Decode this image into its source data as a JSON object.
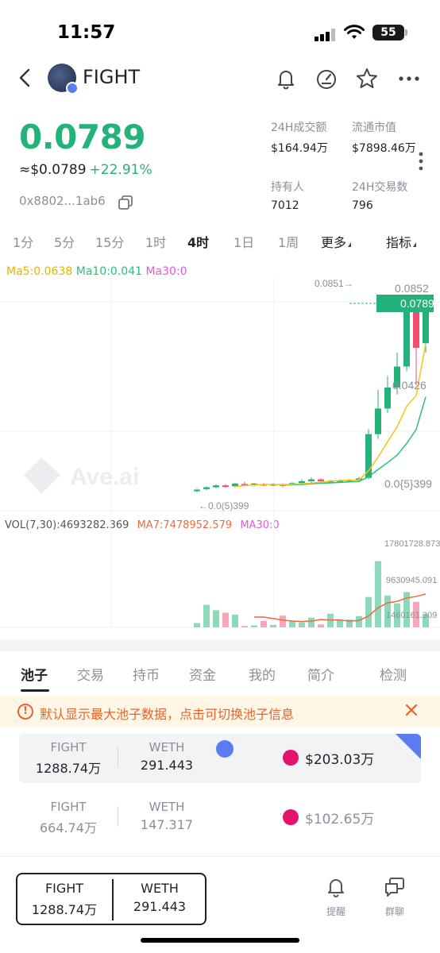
{
  "status_bar": {
    "time": "11:57",
    "battery": "55"
  },
  "header": {
    "token_name": "FIGHT"
  },
  "price": {
    "main": "0.0789",
    "usd": "≈$0.0789",
    "change": "+22.91%",
    "address": "0x8802...1ab6"
  },
  "stats": {
    "vol24h_label": "24H成交额",
    "vol24h_value": "$164.94万",
    "mcap_label": "流通市值",
    "mcap_value": "$7898.46万",
    "holders_label": "持有人",
    "holders_value": "7012",
    "tx24h_label": "24H交易数",
    "tx24h_value": "796"
  },
  "timeframes": [
    "1分",
    "5分",
    "15分",
    "1时",
    "4时",
    "1日",
    "1周",
    "更多",
    "指标"
  ],
  "active_timeframe": "4时",
  "chart": {
    "ma5": "Ma5:0.0638",
    "ma10": "Ma10:0.041",
    "ma30": "Ma30:0",
    "price_ticks": [
      "0.0852",
      "0.0426",
      "0.0{5}399"
    ],
    "current_tag": "0.0789",
    "high_marker": "0.0851→",
    "low_marker": "←0.0(5)399",
    "watermark": "Ave.ai",
    "vol_label": "VOL(7,30):4693282.369",
    "vol_ma7": "MA7:7478952.579",
    "vol_ma30": "MA30:0",
    "vol_ticks": [
      "17801728.873",
      "9630945.091",
      "1460161.309"
    ],
    "colors": {
      "up": "#23b27a",
      "down": "#f0506e",
      "ma5": "#f5c518",
      "ma10": "#2bbf7a",
      "ma30": "#e05ad6",
      "vol_ma7": "#ee6a3a"
    }
  },
  "chart_data": {
    "type": "candlestick",
    "ylim": [
      0,
      0.0852
    ],
    "candles": [
      {
        "o": 0.0005,
        "c": 0.0012,
        "h": 0.0016,
        "l": 0.0
      },
      {
        "o": 0.0014,
        "c": 0.0022,
        "h": 0.0026,
        "l": 0.001
      },
      {
        "o": 0.0022,
        "c": 0.003,
        "h": 0.0034,
        "l": 0.0018
      },
      {
        "o": 0.003,
        "c": 0.0026,
        "h": 0.0036,
        "l": 0.002
      },
      {
        "o": 0.0026,
        "c": 0.0038,
        "h": 0.0042,
        "l": 0.0022
      },
      {
        "o": 0.0036,
        "c": 0.003,
        "h": 0.0046,
        "l": 0.0028
      },
      {
        "o": 0.003,
        "c": 0.0038,
        "h": 0.004,
        "l": 0.0026
      },
      {
        "o": 0.0036,
        "c": 0.0032,
        "h": 0.004,
        "l": 0.0026
      },
      {
        "o": 0.003,
        "c": 0.0036,
        "h": 0.004,
        "l": 0.0026
      },
      {
        "o": 0.0036,
        "c": 0.0028,
        "h": 0.0038,
        "l": 0.0022
      },
      {
        "o": 0.0034,
        "c": 0.004,
        "h": 0.0044,
        "l": 0.003
      },
      {
        "o": 0.004,
        "c": 0.0048,
        "h": 0.0056,
        "l": 0.0036
      },
      {
        "o": 0.0048,
        "c": 0.0056,
        "h": 0.0064,
        "l": 0.0042
      },
      {
        "o": 0.0056,
        "c": 0.0048,
        "h": 0.006,
        "l": 0.004
      },
      {
        "o": 0.0048,
        "c": 0.005,
        "h": 0.0054,
        "l": 0.004
      },
      {
        "o": 0.0048,
        "c": 0.0052,
        "h": 0.0056,
        "l": 0.004
      },
      {
        "o": 0.005,
        "c": 0.0054,
        "h": 0.0058,
        "l": 0.0044
      },
      {
        "o": 0.0052,
        "c": 0.006,
        "h": 0.0066,
        "l": 0.0046
      },
      {
        "o": 0.0062,
        "c": 0.025,
        "h": 0.027,
        "l": 0.0056
      },
      {
        "o": 0.025,
        "c": 0.036,
        "h": 0.044,
        "l": 0.023
      },
      {
        "o": 0.036,
        "c": 0.045,
        "h": 0.05,
        "l": 0.034
      },
      {
        "o": 0.045,
        "c": 0.054,
        "h": 0.06,
        "l": 0.042
      },
      {
        "o": 0.054,
        "c": 0.08,
        "h": 0.082,
        "l": 0.052
      },
      {
        "o": 0.08,
        "c": 0.062,
        "h": 0.082,
        "l": 0.046
      },
      {
        "o": 0.064,
        "c": 0.08,
        "h": 0.0851,
        "l": 0.06
      }
    ],
    "ma5": [
      null,
      null,
      null,
      null,
      0.0025,
      0.0029,
      0.0032,
      0.0034,
      0.0034,
      0.0033,
      0.0035,
      0.0037,
      0.004,
      0.0044,
      0.0048,
      0.0051,
      0.0052,
      0.0053,
      0.0093,
      0.0151,
      0.0217,
      0.0281,
      0.0369,
      0.0416,
      0.0638
    ],
    "ma10": [
      null,
      null,
      null,
      null,
      null,
      null,
      null,
      null,
      null,
      0.0031,
      0.0033,
      0.0034,
      0.0037,
      0.0039,
      0.0041,
      0.0043,
      0.0045,
      0.0047,
      0.0067,
      0.0098,
      0.0128,
      0.016,
      0.021,
      0.027,
      0.041
    ],
    "volume": [
      0.9,
      4.6,
      3.5,
      3.0,
      2.6,
      0.3,
      0.4,
      1.3,
      0.5,
      2.4,
      1.2,
      1.0,
      2.0,
      0.6,
      2.8,
      1.4,
      1.6,
      2.3,
      6.2,
      13.5,
      6.5,
      4.9,
      7.2,
      5.2,
      2.7
    ],
    "vol_ma7": [
      null,
      null,
      null,
      null,
      null,
      null,
      2.1,
      2.1,
      1.8,
      1.5,
      1.3,
      1.2,
      1.3,
      1.6,
      1.5,
      1.5,
      1.3,
      1.4,
      2.3,
      4.0,
      5.0,
      5.3,
      6.0,
      6.3,
      6.8
    ],
    "vol_ylim": [
      0,
      17.8
    ]
  },
  "bottom_tabs": [
    "池子",
    "交易",
    "持币",
    "资金",
    "我的",
    "简介",
    "检测"
  ],
  "active_bottom_tab": "池子",
  "notice": {
    "text": "默认显示最大池子数据，点击可切换池子信息"
  },
  "pools": [
    {
      "token_a": "FIGHT",
      "amount_a": "1288.74万",
      "token_b": "WETH",
      "amount_b": "291.443",
      "liquidity": "$203.03万"
    },
    {
      "token_a": "FIGHT",
      "amount_a": "664.74万",
      "token_b": "WETH",
      "amount_b": "147.317",
      "liquidity": "$102.65万"
    }
  ],
  "footer": {
    "pair_a": "FIGHT",
    "pair_a_amount": "1288.74万",
    "pair_b": "WETH",
    "pair_b_amount": "291.443",
    "alert_label": "提醒",
    "group_label": "群聊"
  }
}
